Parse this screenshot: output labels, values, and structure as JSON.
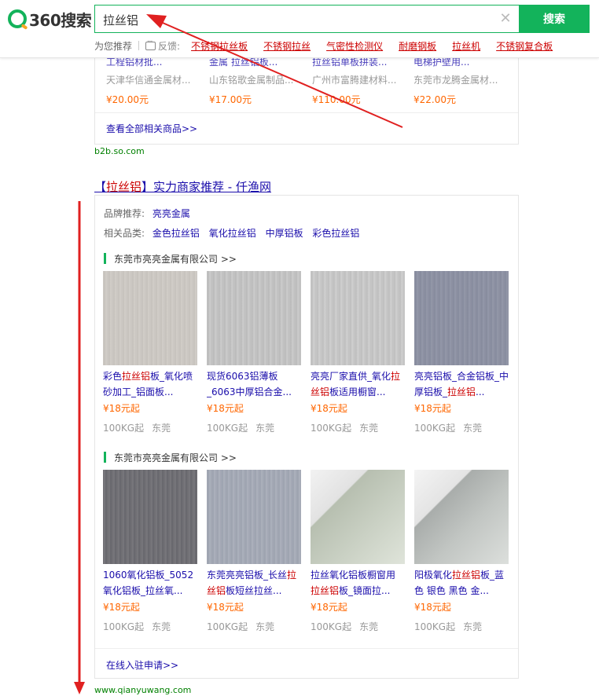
{
  "header": {
    "logo_text": "360搜索",
    "search_value": "拉丝铝",
    "clear_glyph": "✕",
    "search_button": "搜索",
    "suggest_label": "为您推荐",
    "feedback_label": "反馈:",
    "suggestions": [
      "不锈钢拉丝板",
      "不锈钢拉丝",
      "气密性检测仪",
      "耐磨钢板",
      "拉丝机",
      "不锈钢复合板"
    ]
  },
  "b2b": {
    "items": [
      {
        "title": "工程铝材批...",
        "company": "天津华信通金属材...",
        "price": "¥20.00元"
      },
      {
        "title": "金属 拉丝铝板...",
        "company": "山东铭歌金属制品...",
        "price": "¥17.00元"
      },
      {
        "title": "拉丝铝单板拼装...",
        "company": "广州市富腾建材料...",
        "price": "¥110.00元"
      },
      {
        "title": "电梯护壁用...",
        "company": "东莞市龙腾金属材...",
        "price": "¥22.00元"
      }
    ],
    "more_link": "查看全部相关商品>>",
    "url": "b2b.so.com"
  },
  "result": {
    "title_prefix": "【",
    "title_highlight": "拉丝铝",
    "title_suffix": "】实力商家推荐 - 仟渔网",
    "brand_label": "品牌推荐:",
    "brand_value": "亮亮金属",
    "category_label": "相关品类:",
    "categories": [
      "金色拉丝铝",
      "氧化拉丝铝",
      "中厚铝板",
      "彩色拉丝铝"
    ],
    "company_name": "东莞市亮亮金属有限公司 >>",
    "products_row1": [
      {
        "title_pre": "彩色",
        "title_hl": "拉丝铝",
        "title_post": "板_氧化喷砂加工_铝面板...",
        "price": "¥18元起",
        "moq": "100KG起",
        "city": "东莞"
      },
      {
        "title_pre": "现货6063铝薄板_6063中厚铝合金...",
        "title_hl": "",
        "title_post": "",
        "price": "¥18元起",
        "moq": "100KG起",
        "city": "东莞"
      },
      {
        "title_pre": "亮亮厂家直供_氧化",
        "title_hl": "拉丝铝",
        "title_post": "板适用橱窗...",
        "price": "¥18元起",
        "moq": "100KG起",
        "city": "东莞"
      },
      {
        "title_pre": "亮亮铝板_合金铝板_中厚铝板_",
        "title_hl": "拉丝铝",
        "title_post": "...",
        "price": "¥18元起",
        "moq": "100KG起",
        "city": "东莞"
      }
    ],
    "products_row2": [
      {
        "title_pre": "1060氧化铝板_5052氧化铝板_拉丝氧...",
        "title_hl": "",
        "title_post": "",
        "price": "¥18元起",
        "moq": "100KG起",
        "city": "东莞"
      },
      {
        "title_pre": "东莞亮亮铝板_长丝",
        "title_hl": "拉丝铝",
        "title_post": "板短丝拉丝...",
        "price": "¥18元起",
        "moq": "100KG起",
        "city": "东莞"
      },
      {
        "title_pre": "拉丝氧化铝板橱窗用",
        "title_hl": "拉丝铝",
        "title_post": "板_镜面拉...",
        "price": "¥18元起",
        "moq": "100KG起",
        "city": "东莞"
      },
      {
        "title_pre": "阳极氧化",
        "title_hl": "拉丝铝",
        "title_post": "板_蓝色 银色 黑色 金...",
        "price": "¥18元起",
        "moq": "100KG起",
        "city": "东莞"
      }
    ],
    "apply_link": "在线入驻申请>>",
    "url": "www.qianyuwang.com"
  },
  "colors": {
    "brand_green": "#13b35b",
    "link_blue": "#1a0dab",
    "highlight_red": "#c00",
    "price_orange": "#f60",
    "annotation_red": "#e02020"
  }
}
